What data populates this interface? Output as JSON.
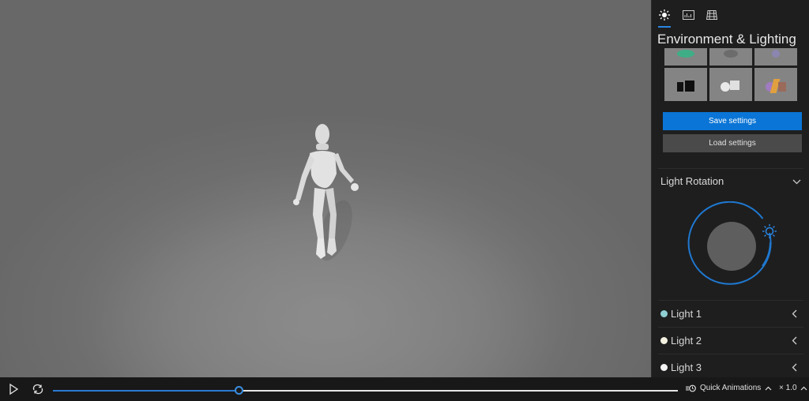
{
  "panel": {
    "tabs": [
      {
        "name": "environment-lighting",
        "icon": "sun-icon",
        "active": true
      },
      {
        "name": "statistics",
        "icon": "chart-panel-icon",
        "active": false
      },
      {
        "name": "grid",
        "icon": "grid-icon",
        "active": false
      }
    ],
    "title": "Environment & Lighting",
    "save_label": "Save settings",
    "load_label": "Load settings",
    "light_rotation": {
      "label": "Light Rotation",
      "expanded": true
    },
    "lights": [
      {
        "label": "Light 1",
        "color": "#8fcfd4"
      },
      {
        "label": "Light 2",
        "color": "#f3f1df"
      },
      {
        "label": "Light 3",
        "color": "#f4f4f4"
      }
    ]
  },
  "playback": {
    "play_icon": "play-icon",
    "loop_icon": "loop-icon",
    "progress": 0.297,
    "quick_animations_label": "Quick Animations",
    "speed_label": "× 1.0"
  },
  "colors": {
    "accent": "#0a75d6",
    "panel_bg": "#1e1e1e",
    "viewport_bg": "#6e6e6e"
  }
}
